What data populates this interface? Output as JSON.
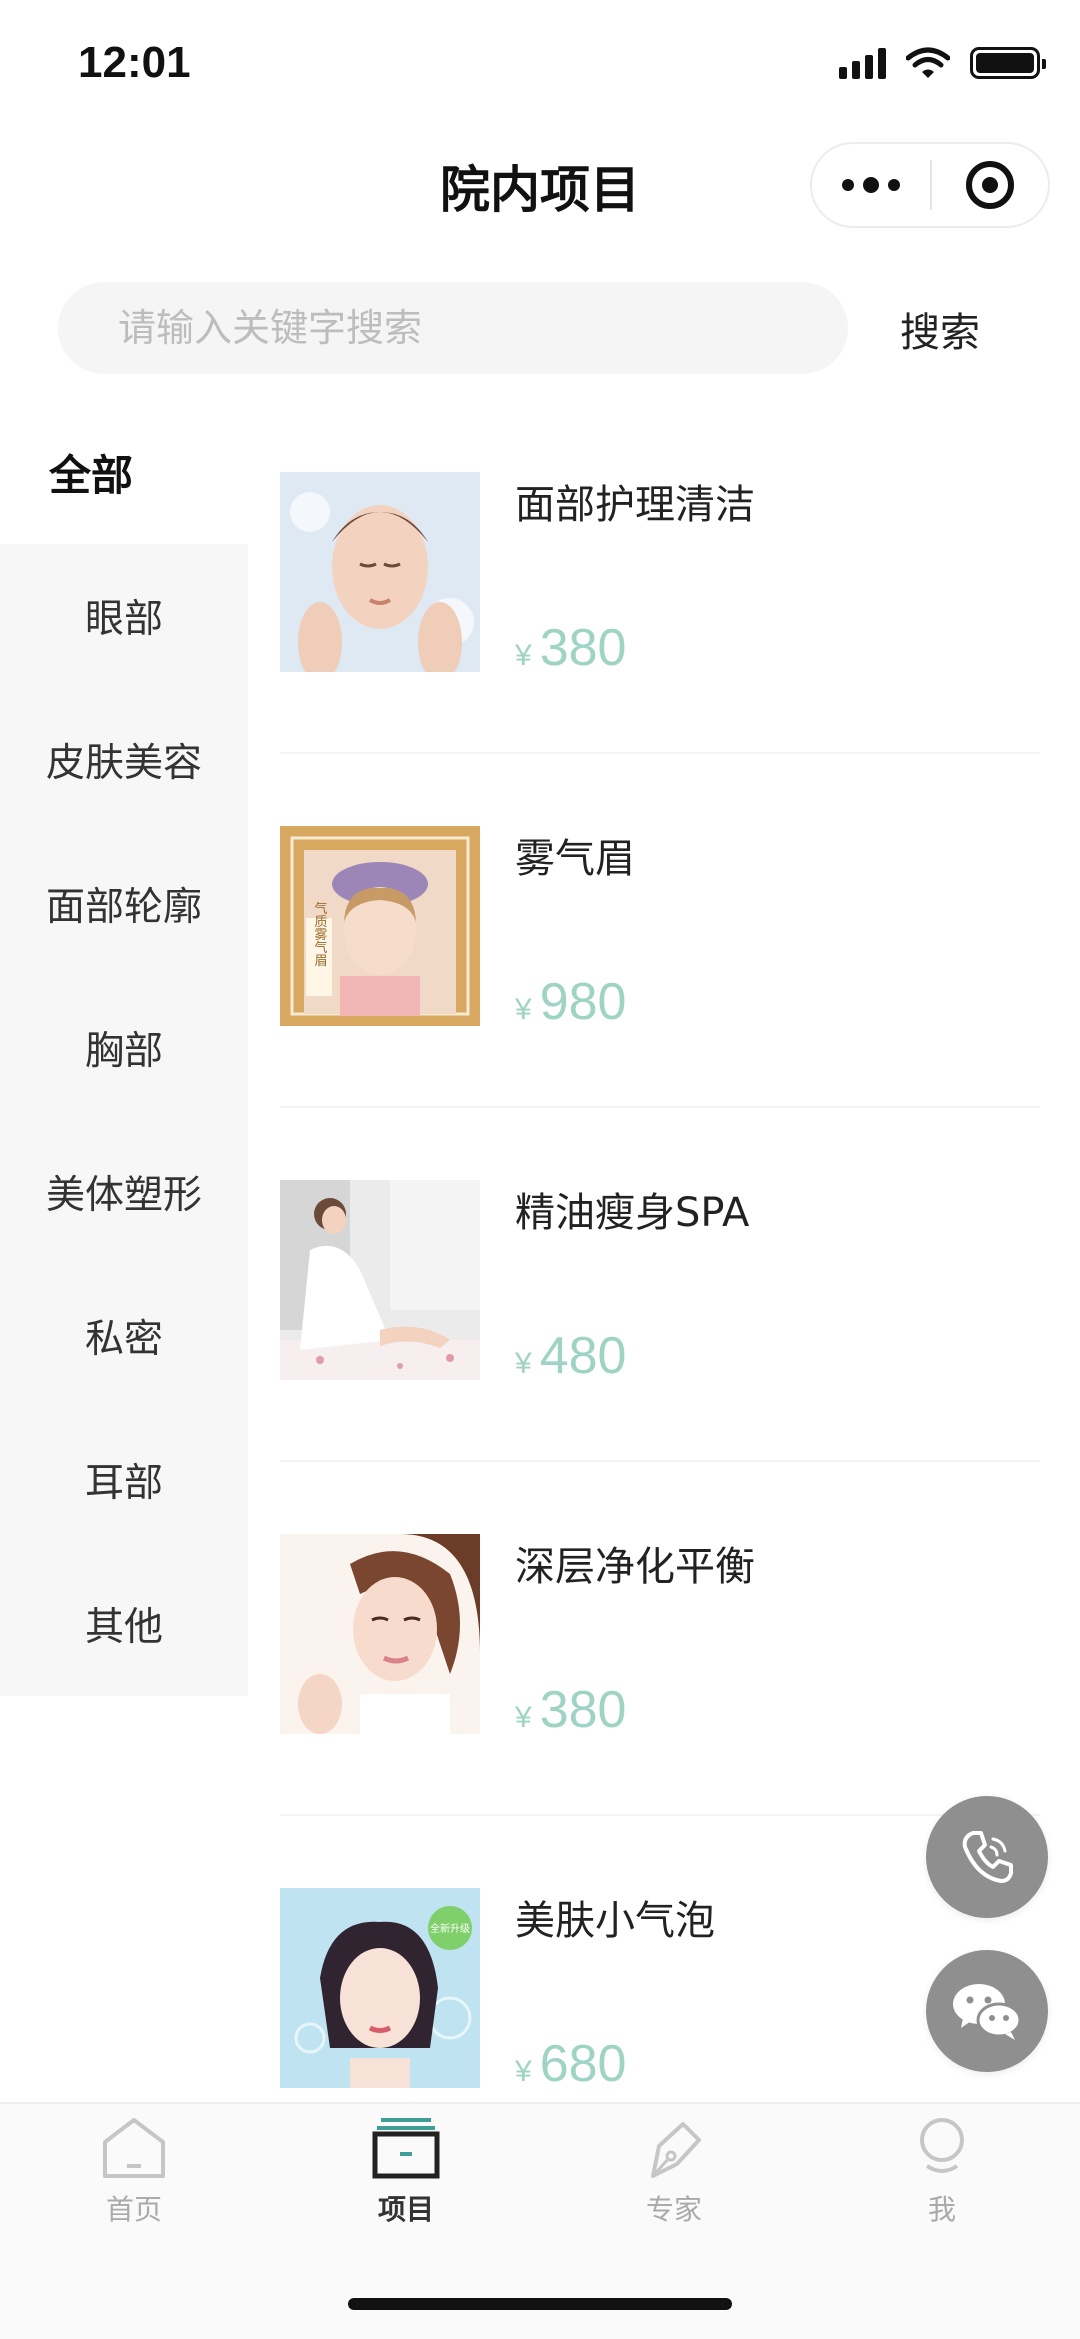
{
  "status_bar": {
    "time": "12:01"
  },
  "nav": {
    "title": "院内项目"
  },
  "search": {
    "placeholder": "请输入关键字搜索",
    "value": "",
    "button_label": "搜索"
  },
  "categories": [
    {
      "label": "全部",
      "active": true
    },
    {
      "label": "眼部"
    },
    {
      "label": "皮肤美容"
    },
    {
      "label": "面部轮廓"
    },
    {
      "label": "胸部"
    },
    {
      "label": "美体塑形"
    },
    {
      "label": "私密"
    },
    {
      "label": "耳部"
    },
    {
      "label": "其他"
    }
  ],
  "currency_symbol": "¥",
  "products": [
    {
      "name": "面部护理清洁",
      "price": "380"
    },
    {
      "name": "雾气眉",
      "price": "980"
    },
    {
      "name": "精油瘦身SPA",
      "price": "480"
    },
    {
      "name": "深层净化平衡",
      "price": "380"
    },
    {
      "name": "美肤小气泡",
      "price": "680"
    }
  ],
  "thumb_texts": {
    "brow_badge": "气质雾气眉",
    "bubble_badge": "全新升级"
  },
  "tabbar": {
    "items": [
      {
        "label": "首页",
        "icon": "home-icon"
      },
      {
        "label": "项目",
        "icon": "project-icon",
        "active": true
      },
      {
        "label": "专家",
        "icon": "pen-icon"
      },
      {
        "label": "我",
        "icon": "profile-icon"
      }
    ]
  },
  "colors": {
    "price": "#9fd3c4",
    "accent": "#3f9e95",
    "fab": "#8f8f8f"
  }
}
